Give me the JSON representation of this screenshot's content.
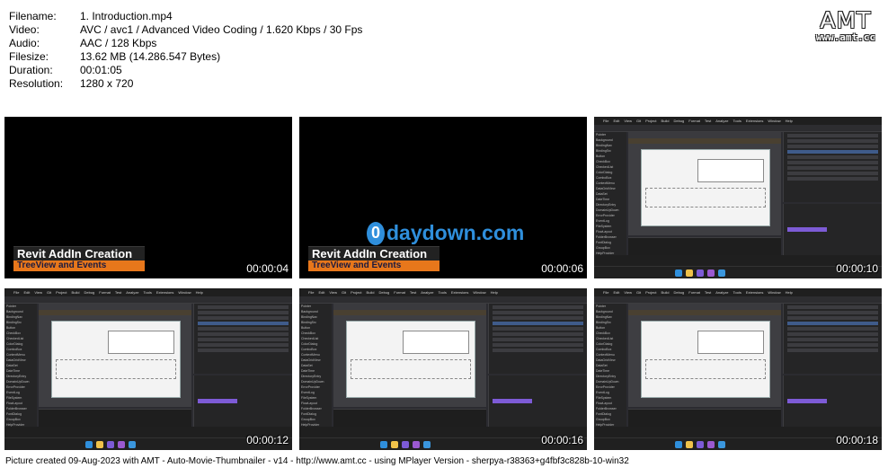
{
  "meta": {
    "rows": [
      {
        "key": "Filename:",
        "value": "1. Introduction.mp4"
      },
      {
        "key": "Video:",
        "value": "AVC / avc1 / Advanced Video Coding / 1.620 Kbps / 30 Fps"
      },
      {
        "key": "Audio:",
        "value": "AAC / 128 Kbps"
      },
      {
        "key": "Filesize:",
        "value": "13.62 MB (14.286.547 Bytes)"
      },
      {
        "key": "Duration:",
        "value": "00:01:05"
      },
      {
        "key": "Resolution:",
        "value": "1280 x 720"
      }
    ]
  },
  "logo": {
    "title": "AMT",
    "url": "www.amt.cc"
  },
  "intro": {
    "title": "Revit AddIn Creation",
    "subtitle": "TreeView and Events",
    "watermark": "daydown.com"
  },
  "thumbnails": [
    {
      "timestamp": "00:00:04",
      "kind": "intro"
    },
    {
      "timestamp": "00:00:06",
      "kind": "intro-watermark"
    },
    {
      "timestamp": "00:00:10",
      "kind": "ide"
    },
    {
      "timestamp": "00:00:12",
      "kind": "ide"
    },
    {
      "timestamp": "00:00:16",
      "kind": "ide"
    },
    {
      "timestamp": "00:00:18",
      "kind": "ide"
    }
  ],
  "ide": {
    "menu": [
      "File",
      "Edit",
      "View",
      "Git",
      "Project",
      "Build",
      "Debug",
      "Format",
      "Test",
      "Analyze",
      "Tools",
      "Extensions",
      "Window",
      "Help"
    ],
    "toolbox_items": [
      "Pointer",
      "Background",
      "BindingNav",
      "BindingSrc",
      "Button",
      "CheckBox",
      "CheckedList",
      "ColorDialog",
      "ComboBox",
      "ContextMenu",
      "DataGridView",
      "DataSet",
      "DateTime",
      "DirectoryEntry",
      "DomainUpDown",
      "ErrorProvider",
      "EventLog",
      "FileSystem",
      "FlowLayout",
      "FolderBrowser",
      "FontDialog",
      "GroupBox",
      "HelpProvider"
    ],
    "colors": {
      "accent": "#7d5bd6",
      "selection": "#3f5b8a",
      "banner": "#494031"
    }
  },
  "footer": "Picture created 09-Aug-2023 with AMT - Auto-Movie-Thumbnailer - v14 - http://www.amt.cc - using MPlayer Version - sherpya-r38363+g4fbf3c828b-10-win32"
}
